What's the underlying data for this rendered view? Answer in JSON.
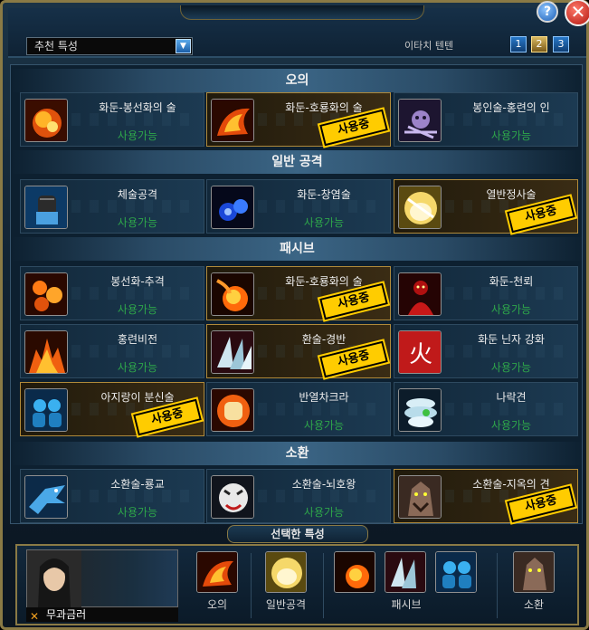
{
  "window": {
    "controls": {
      "help": "?",
      "close": "✕"
    }
  },
  "toolbar": {
    "dropdown_value": "추천 특성",
    "dropdown_arrow": "▼",
    "page_label": "이타치 텐텐",
    "pages": [
      "1",
      "2",
      "3"
    ],
    "active_page": "2"
  },
  "sections": {
    "ougi": "오의",
    "normal_attack": "일반 공격",
    "passive": "패시브",
    "summon": "소환"
  },
  "skills": {
    "s1": {
      "name": "화둔-봉선화의 술",
      "status": "사용가능",
      "in_use": false
    },
    "s2": {
      "name": "화둔-호룡화의 술",
      "status": "사용중",
      "in_use": true
    },
    "s3": {
      "name": "봉인술-홍련의 인",
      "status": "사용가능",
      "in_use": false
    },
    "s4": {
      "name": "체술공격",
      "status": "사용가능",
      "in_use": false
    },
    "s5": {
      "name": "화둔-창염술",
      "status": "사용가능",
      "in_use": false
    },
    "s6": {
      "name": "열반정사술",
      "status": "사용중",
      "in_use": true
    },
    "s7": {
      "name": "봉선화-추격",
      "status": "사용가능",
      "in_use": false
    },
    "s8": {
      "name": "화둔-호룡화의 술",
      "status": "사용중",
      "in_use": true
    },
    "s9": {
      "name": "화둔-천뢰",
      "status": "사용가능",
      "in_use": false
    },
    "s10": {
      "name": "홍련비전",
      "status": "사용가능",
      "in_use": false
    },
    "s11": {
      "name": "환술-경반",
      "status": "사용중",
      "in_use": true
    },
    "s12": {
      "name": "화둔 닌자 강화",
      "status": "사용가능",
      "in_use": false
    },
    "s13": {
      "name": "아지랑이 분신술",
      "status": "사용중",
      "in_use": true
    },
    "s14": {
      "name": "반열차크라",
      "status": "사용가능",
      "in_use": false
    },
    "s15": {
      "name": "나락견",
      "status": "사용가능",
      "in_use": false
    },
    "s16": {
      "name": "소환술-룡교",
      "status": "사용가능",
      "in_use": false
    },
    "s17": {
      "name": "소환술-뇌호왕",
      "status": "사용가능",
      "in_use": false
    },
    "s18": {
      "name": "소환술-지옥의 견",
      "status": "사용중",
      "in_use": true
    }
  },
  "stamp_label": "사용중",
  "selected": {
    "title": "선택한 특성",
    "character_name": "무과금러",
    "labels": {
      "ougi": "오의",
      "normal_attack": "일반공격",
      "passive": "패시브",
      "summon": "소환"
    }
  },
  "icons": {
    "s1": "fire-swirl-icon",
    "s2": "fire-dragon-icon",
    "s3": "seal-chains-icon",
    "s4": "fist-icon",
    "s5": "blue-flame-icon",
    "s6": "glowing-fist-icon",
    "s7": "fire-burst-icon",
    "s8": "fireball-icon",
    "s9": "red-figure-icon",
    "s10": "flames-icon",
    "s11": "crystal-shards-icon",
    "s12": "fire-kanji-icon",
    "s13": "twin-clones-icon",
    "s14": "flaming-fist-icon",
    "s15": "spiral-hound-icon",
    "s16": "blue-dragon-icon",
    "s17": "thunder-tiger-icon",
    "s18": "hell-hound-icon"
  },
  "colors": {
    "available_text": "#2ea64a",
    "stamp_bg": "#ffcc00",
    "frame_gold": "#8a7a45"
  }
}
